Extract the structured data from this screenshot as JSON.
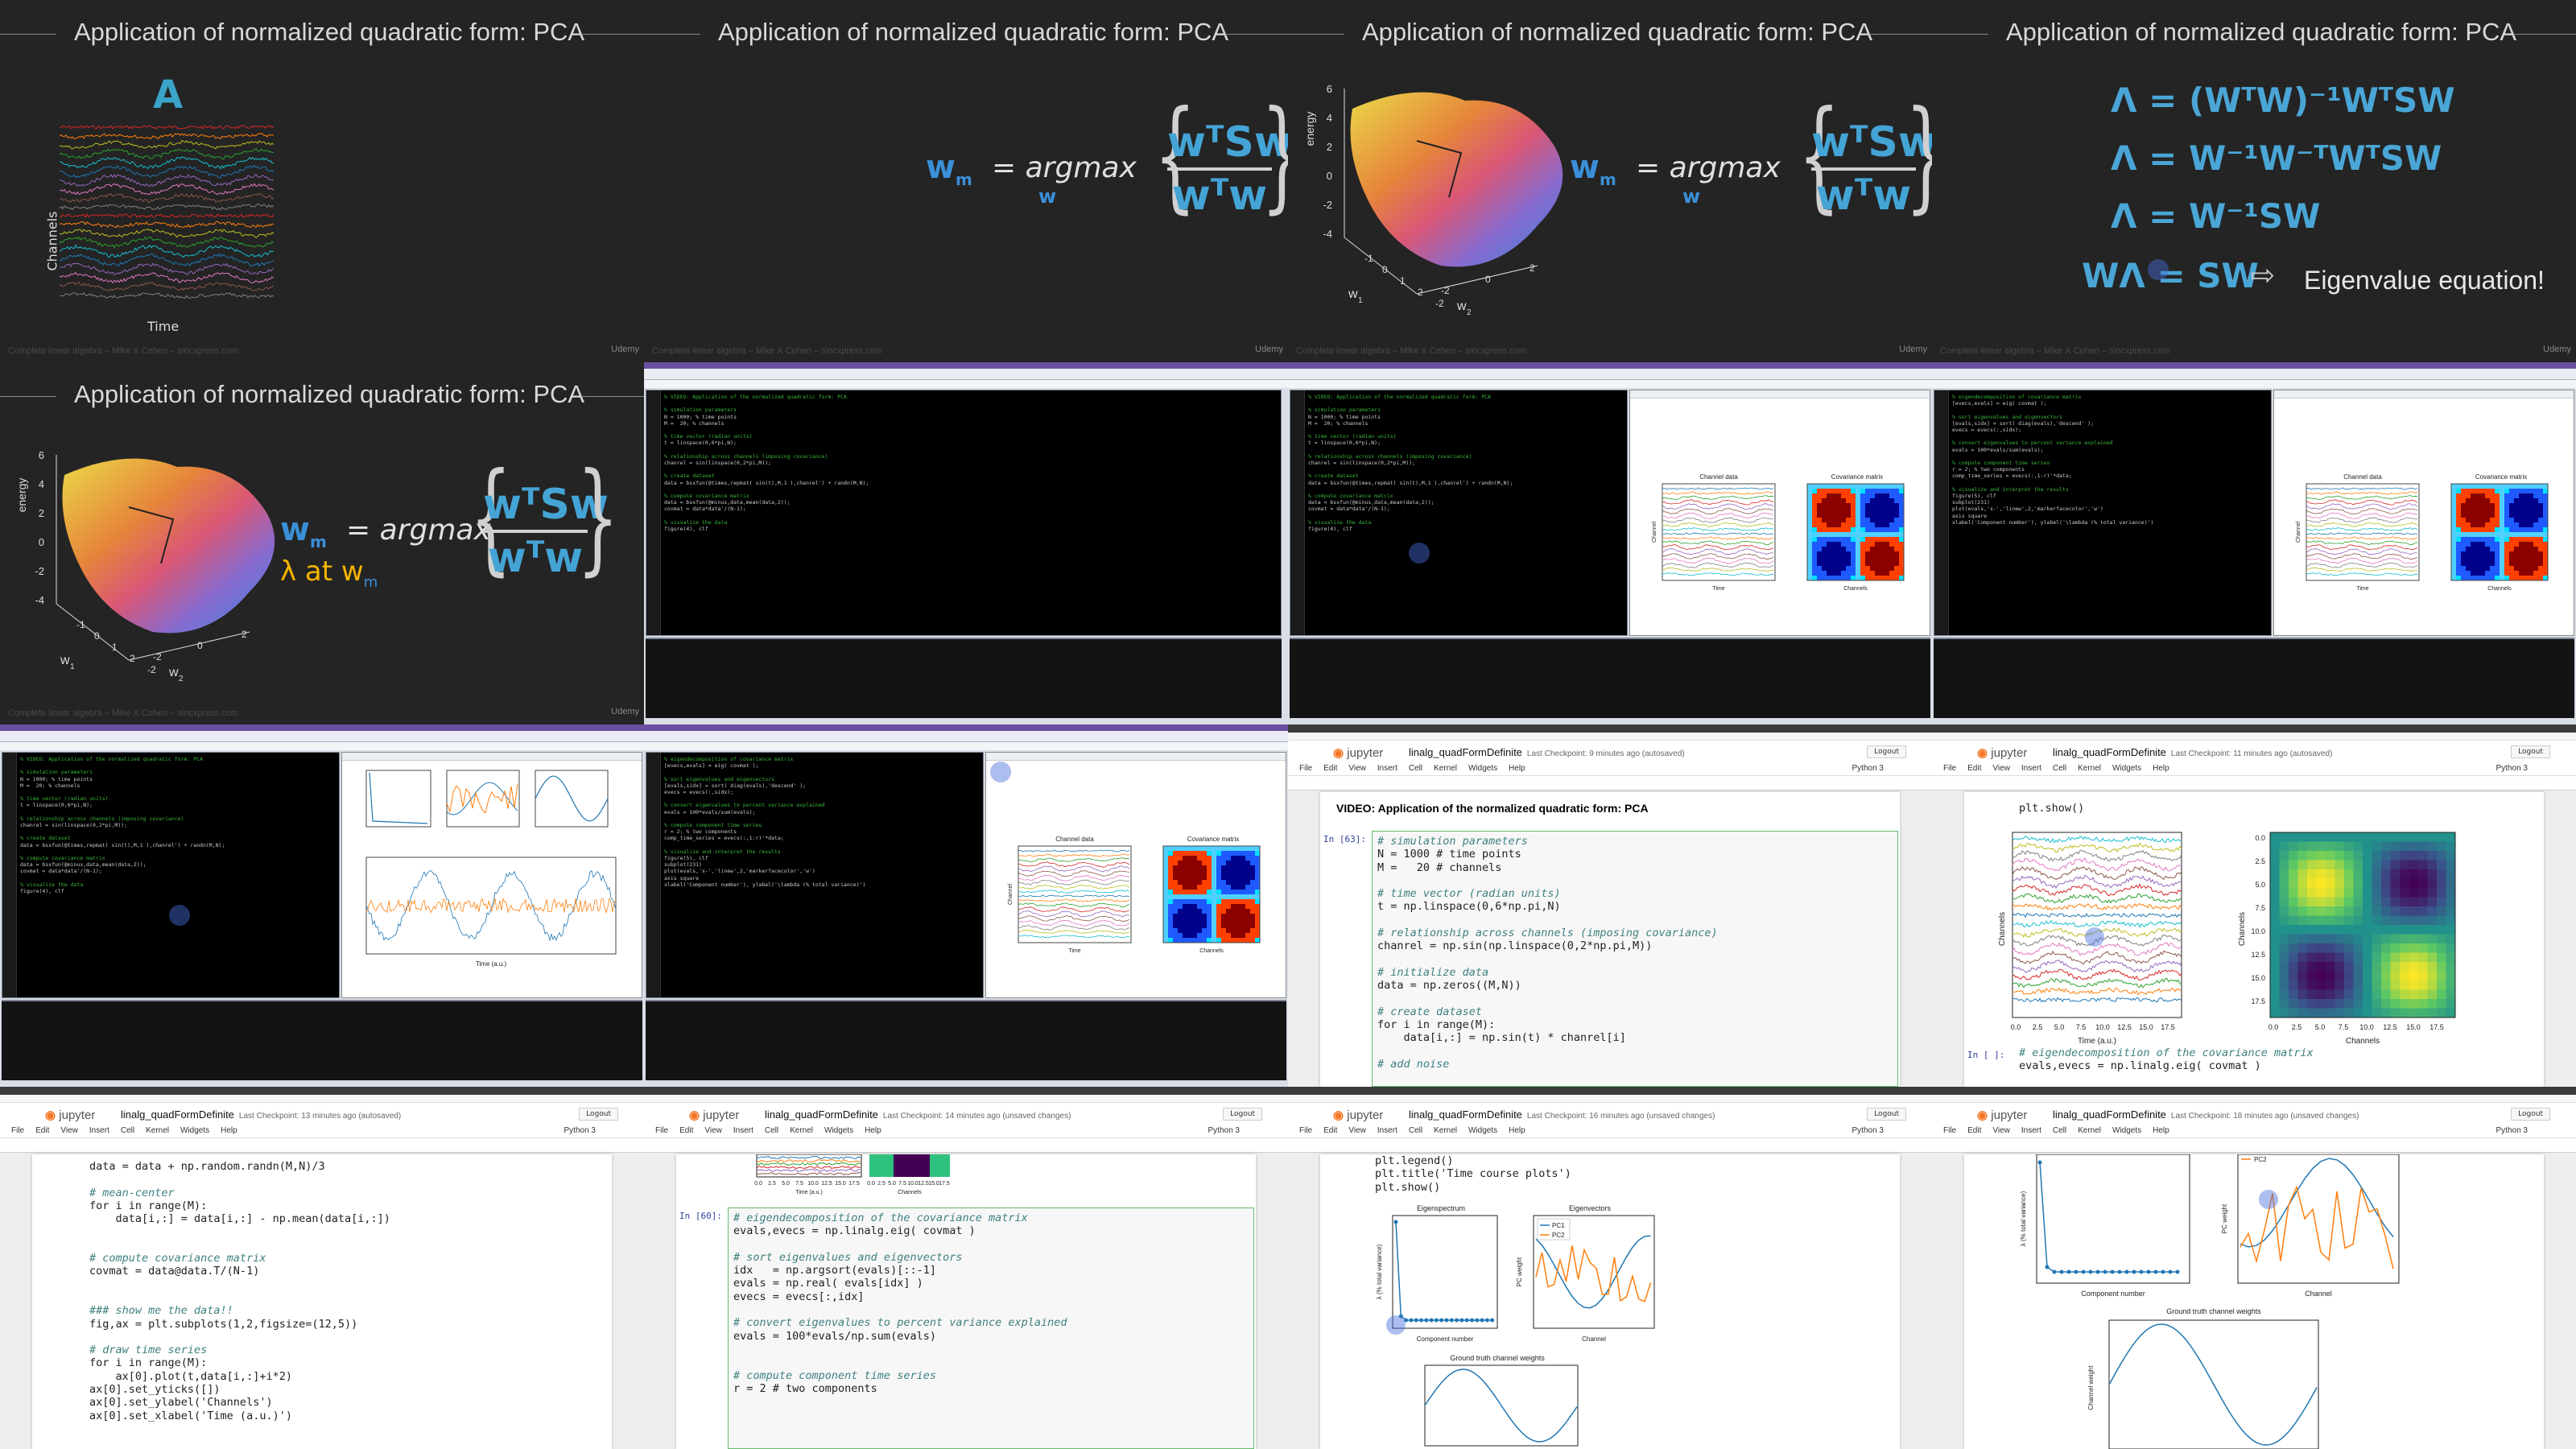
{
  "slide_title": "Application of normalized quadratic form: PCA",
  "footer_text": "Complete linear algebra – Mike X Cohen – sincxpress.com",
  "udemy": "Udemy",
  "slide1": {
    "matrix_label": "A",
    "ylabel": "Channels",
    "xlabel": "Time"
  },
  "formula": {
    "w": "w",
    "m": "m",
    "eq": "= argmax",
    "under": "w",
    "num": "wᵀSw",
    "den": "wᵀw"
  },
  "surface": {
    "zlabel": "energy",
    "w1": "w",
    "w1sub": "1",
    "w2": "w",
    "w2sub": "2",
    "zticks": [
      "6",
      "4",
      "2",
      "0",
      "-2",
      "-4"
    ],
    "xticks": [
      "-1",
      "0",
      "1",
      "2",
      "-2"
    ],
    "yticks": [
      "-2",
      "0",
      "2"
    ]
  },
  "slide4": {
    "lines": [
      "Λ = (WᵀW)⁻¹WᵀSW",
      "Λ = W⁻¹W⁻ᵀWᵀSW",
      "Λ = W⁻¹SW"
    ],
    "last_left": "WΛ = SW",
    "arrow": "⇨",
    "note": "Eigenvalue equation!"
  },
  "slide5": {
    "lambda_text": "λ at w",
    "lambda_sub": "m"
  },
  "matlab": {
    "code_a": [
      "% VIDEO: Application of the normalized quadratic form: PCA",
      "",
      "% simulation parameters",
      "N = 1000; % time points",
      "M =  20; % channels",
      "",
      "% time vector (radian units)",
      "t = linspace(0,6*pi,N);",
      "",
      "% relationship across channels (imposing covariance)",
      "chanrel = sin(linspace(0,2*pi,M));",
      "",
      "% create dataset",
      "data = bsxfun(@times,repmat( sin(t),M,1 ),chanrel') + randn(M,N);",
      "",
      "% compute covariance matrix",
      "data = bsxfun(@minus,data,mean(data,2));",
      "covmat = data*data'/(N-1);",
      "",
      "% visualize the data",
      "figure(4), clf"
    ],
    "code_b": [
      "% eigendecomposition of covariance matrix",
      "[evecs,evals] = eig( covmat );",
      "",
      "% sort eigenvalues and eigenvectors",
      "[evals,sidx] = sort( diag(evals),'descend' );",
      "evecs = evecs(:,sidx);",
      "",
      "% convert eigenvalues to percent variance explained",
      "evals = 100*evals/sum(evals);",
      "",
      "% compute component time series",
      "r = 2; % two components",
      "comp_time_series = evecs(:,1:r)'*data;",
      "",
      "% visualize and interpret the results",
      "figure(5), clf",
      "subplot(231)",
      "plot(evals,'s-','linew',2,'markerfacecolor','w')",
      "axis square",
      "xlabel('Component number'), ylabel('\\lambda (% total variance)')"
    ],
    "fig_titles": [
      "Channel data",
      "Covariance matrix"
    ],
    "fig_xlabels": [
      "Time",
      "Channels"
    ],
    "fig_ylabel": "Channel"
  },
  "jupyter": {
    "brand": "jupyter",
    "notebook": "linalg_quadFormDefinite",
    "checkpoints": [
      "Last Checkpoint: 9 minutes ago  (autosaved)",
      "Last Checkpoint: 11 minutes ago  (autosaved)",
      "Last Checkpoint: 13 minutes ago  (autosaved)",
      "Last Checkpoint: 14 minutes ago  (unsaved changes)",
      "Last Checkpoint: 16 minutes ago  (unsaved changes)",
      "Last Checkpoint: 18 minutes ago  (unsaved changes)"
    ],
    "logout": "Logout",
    "kernel": "Python 3",
    "menu": [
      "File",
      "Edit",
      "View",
      "Insert",
      "Cell",
      "Kernel",
      "Widgets",
      "Help"
    ],
    "heading": "VIDEO: Application of the normalized quadratic form: PCA",
    "prompt_63": "In [63]:",
    "prompt_60": "In [60]:",
    "prompt_empty": "In [ ]:",
    "cell1": [
      "# simulation parameters",
      "N = 1000 # time points",
      "M =   20 # channels",
      "",
      "# time vector (radian units)",
      "t = np.linspace(0,6*np.pi,N)",
      "",
      "# relationship across channels (imposing covariance)",
      "chanrel = np.sin(np.linspace(0,2*np.pi,M))",
      "",
      "# initialize data",
      "data = np.zeros((M,N))",
      "",
      "# create dataset",
      "for i in range(M):",
      "    data[i,:] = np.sin(t) * chanrel[i]",
      "",
      "# add noise"
    ],
    "pltshow": "plt.show()",
    "eig_line1": "# eigendecomposition of the covariance matrix",
    "eig_line2": "evals,evecs = np.linalg.eig( covmat )",
    "cell3": [
      "data = data + np.random.randn(M,N)/3",
      "",
      "# mean-center",
      "for i in range(M):",
      "    data[i,:] = data[i,:] - np.mean(data[i,:])",
      "",
      "",
      "# compute covariance matrix",
      "covmat = data@data.T/(N-1)",
      "",
      "",
      "### show me the data!!",
      "fig,ax = plt.subplots(1,2,figsize=(12,5))",
      "",
      "# draw time series",
      "for i in range(M):",
      "    ax[0].plot(t,data[i,:]+i*2)",
      "ax[0].set_yticks([])",
      "ax[0].set_ylabel('Channels')",
      "ax[0].set_xlabel('Time (a.u.)')"
    ],
    "cell4": [
      "# eigendecomposition of the covariance matrix",
      "evals,evecs = np.linalg.eig( covmat )",
      "",
      "# sort eigenvalues and eigenvectors",
      "idx   = np.argsort(evals)[::-1]",
      "evals = np.real( evals[idx] )",
      "evecs = evecs[:,idx]",
      "",
      "# convert eigenvalues to percent variance explained",
      "evals = 100*evals/np.sum(evals)",
      "",
      "",
      "# compute component time series",
      "r = 2 # two components"
    ],
    "cell5": [
      "plt.legend()",
      "plt.title('Time course plots')",
      "plt.show()"
    ],
    "plot_titles": [
      "Eigenspectrum",
      "Eigenvectors",
      "Ground truth channel weights"
    ],
    "plot_xlabels": [
      "Component number",
      "Channel"
    ],
    "legend": [
      "PC1",
      "PC2"
    ],
    "axis_labels": {
      "channels": "Channels",
      "time": "Time (a.u.)",
      "weight": "PC weight",
      "variance": "λ (% total variance)",
      "chanweight": "Channel weight"
    },
    "ticks_time": [
      "0.0",
      "2.5",
      "5.0",
      "7.5",
      "10.0",
      "12.5",
      "15.0",
      "17.5"
    ],
    "ticks_cov": [
      "0.0",
      "2.5",
      "5.0",
      "7.5",
      "10.0",
      "12.5",
      "15.0",
      "17.5"
    ]
  }
}
